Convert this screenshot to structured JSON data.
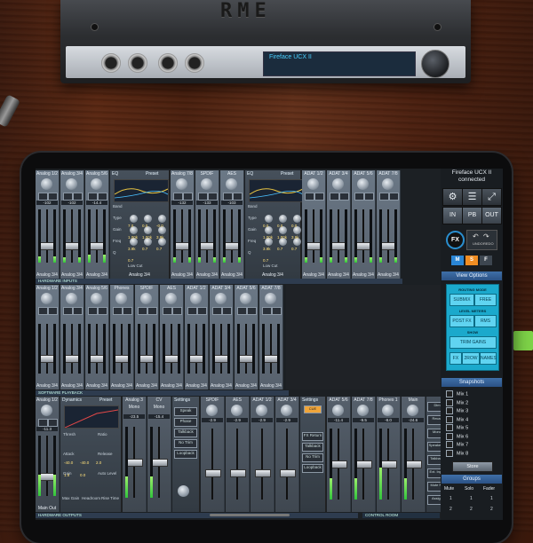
{
  "device": {
    "logo": "RME",
    "display": "Fireface UCX II",
    "colors": {
      "chassis": "#2c2e31",
      "front_panel": "#b9bec5",
      "display_text": "#4ad0ff"
    }
  },
  "colors": {
    "accent_blue": "#2b5185",
    "cyan_panel": "#1ba9cc",
    "meter_green": "#31c43b",
    "desk_wood": "#5a2813"
  },
  "inputs_row": {
    "channels": [
      {
        "name": "Analog 1/2",
        "bottom": "Analog 3/4",
        "level": 0.12
      },
      {
        "name": "Analog 3/4",
        "bottom": "Analog 3/4",
        "level": 0.1
      },
      {
        "name": "Analog 5/6",
        "bottom": "Analog 3/4",
        "level": 0.15
      }
    ],
    "readouts": [
      "-102",
      "-101",
      "-102",
      "-103",
      "-14.4",
      "-14.4"
    ],
    "eq1": {
      "title": "EQ",
      "preset_label": "Preset",
      "labels": [
        "Band",
        "Type",
        "Gain",
        "Freq",
        "Q"
      ],
      "values": [
        "7.0",
        "0.0",
        "-0.0",
        "1.00k",
        "1.00k",
        "3.9k",
        "3.9k",
        "0.7",
        "0.7",
        "0.7"
      ],
      "low_cut": "Low Cut",
      "bottom": "Analog 3/4"
    },
    "channels_b": [
      {
        "name": "Analog 7/8",
        "bottom": "Analog 3/4",
        "level": 0.1
      },
      {
        "name": "SPDIF",
        "bottom": "Analog 3/4",
        "level": 0.1
      },
      {
        "name": "AES",
        "bottom": "Analog 3/4",
        "level": 0.1
      }
    ],
    "readouts_b": [
      "-132",
      "-133",
      "-103",
      "-103"
    ],
    "eq2": {
      "title": "EQ",
      "preset_label": "Preset",
      "labels": [
        "Band",
        "Type",
        "Gain",
        "Freq",
        "Q"
      ],
      "values": [
        "0.0",
        "0.0",
        "0.0",
        "1.00k",
        "1.00k",
        "3.9k",
        "3.9k",
        "0.7",
        "0.7",
        "0.7"
      ],
      "low_cut": "Low Cut",
      "bottom": "Analog 3/4"
    },
    "channels_c": [
      {
        "name": "ADAT 1/2",
        "bottom": "Analog 3/4",
        "level": 0.1
      },
      {
        "name": "ADAT 3/4",
        "bottom": "Analog 3/4",
        "level": 0.1
      },
      {
        "name": "ADAT 5/6",
        "bottom": "Analog 3/4",
        "level": 0.1
      },
      {
        "name": "ADAT 7/8",
        "bottom": "Analog 3/4",
        "level": 0.1
      }
    ],
    "section_label": "HARDWARE INPUTS"
  },
  "playback_row": {
    "channels": [
      {
        "name": "Analog 1/2",
        "bottom": "Analog 3/4"
      },
      {
        "name": "Analog 3/4",
        "bottom": "Analog 3/4"
      },
      {
        "name": "Analog 5/6",
        "bottom": "Analog 3/4"
      },
      {
        "name": "Phones",
        "bottom": "Analog 3/4"
      },
      {
        "name": "SPDIF",
        "bottom": "Analog 3/4"
      },
      {
        "name": "AES",
        "bottom": "Analog 3/4"
      },
      {
        "name": "ADAT 1/2",
        "bottom": "Analog 3/4"
      },
      {
        "name": "ADAT 3/4",
        "bottom": "Analog 3/4"
      },
      {
        "name": "ADAT 5/6",
        "bottom": "Analog 3/4"
      },
      {
        "name": "ADAT 7/8",
        "bottom": "Analog 3/4"
      }
    ],
    "section_label": "SOFTWARE PLAYBACK"
  },
  "output_row": {
    "first": {
      "name": "Analog 1/2",
      "values": [
        "-11.3",
        "-11.6"
      ],
      "bottom": "Main Out"
    },
    "dynamics": {
      "title": "Dynamics",
      "preset_label": "Preset",
      "labels": [
        "Thresh",
        "Ratio",
        "Attack",
        "Release",
        "Gain",
        "Auto Level"
      ],
      "values": [
        "-40.0",
        "-40.0",
        "2.0",
        "1.5",
        "0.0"
      ],
      "bottom_labels": [
        "Max Gain",
        "Headroom",
        "Rise Time"
      ]
    },
    "analog3": {
      "name": "Analog 3",
      "mono": "Mono",
      "value": "-23.5"
    },
    "cv": {
      "name": "CV",
      "mono": "Mono",
      "value": "-15.4"
    },
    "settings": {
      "title": "Settings",
      "buttons": [
        "Speak",
        "Phase",
        "Talkback",
        "No Trim",
        "Loopback"
      ],
      "fx_label": "FX Return"
    },
    "outs": [
      {
        "name": "SPDIF",
        "value": "-2.9"
      },
      {
        "name": "AES",
        "value": "-2.9"
      },
      {
        "name": "ADAT 1/2",
        "value": "-2.9"
      },
      {
        "name": "ADAT 3/4",
        "value": "-2.9"
      }
    ],
    "settings2": {
      "title": "Settings",
      "buttons": [
        "FX Return",
        "Talkback",
        "No Trim",
        "Loopback"
      ],
      "badge": "CUE"
    },
    "adat56": {
      "name": "ADAT 5/6",
      "value": "-11.4"
    },
    "adat7": {
      "name": "ADAT 7/8",
      "value": "-9.5"
    },
    "phones": {
      "name": "Phones 1",
      "values": [
        "-8.0",
        "-8.0"
      ]
    },
    "main": {
      "name": "Main",
      "values": [
        "-24.6",
        "-24.7"
      ]
    },
    "right_buttons": [
      "Dim",
      "Recall",
      "Mono",
      "Speaker B",
      "Talkback",
      "Ext. Input",
      "Mute FX",
      "Assign"
    ],
    "section_label": "HARDWARE OUTPUTS",
    "control_room": "CONTROL ROOM"
  },
  "side_panel": {
    "device_name": "Fireface UCX II",
    "status": "connected",
    "io_buttons": [
      "IN",
      "PB",
      "OUT"
    ],
    "fx_label": "FX",
    "undo_label": "UNDO",
    "redo_label": "REDO",
    "msf": [
      "M",
      "S",
      "F"
    ],
    "view_options": {
      "title": "View Options",
      "routing_mode_label": "ROUTING MODE",
      "submix": "SUBMIX",
      "free": "FREE",
      "level_meters_label": "LEVEL METERS",
      "post_fx": "POST FX",
      "rms": "RMS",
      "show_label": "SHOW",
      "trim_gains": "TRIM GAINS",
      "fx": "FX",
      "2row": "2ROW",
      "names": "NAMES"
    },
    "snapshots": {
      "title": "Snapshots",
      "items": [
        "Mix 1",
        "Mix 2",
        "Mix 3",
        "Mix 4",
        "Mix 5",
        "Mix 6",
        "Mix 7",
        "Mix 8"
      ],
      "store": "Store"
    },
    "groups": {
      "title": "Groups",
      "columns": [
        "Mute",
        "Solo",
        "Fader"
      ],
      "row1": [
        "1",
        "1",
        "1"
      ],
      "row2": [
        "2",
        "2",
        "2"
      ]
    }
  }
}
